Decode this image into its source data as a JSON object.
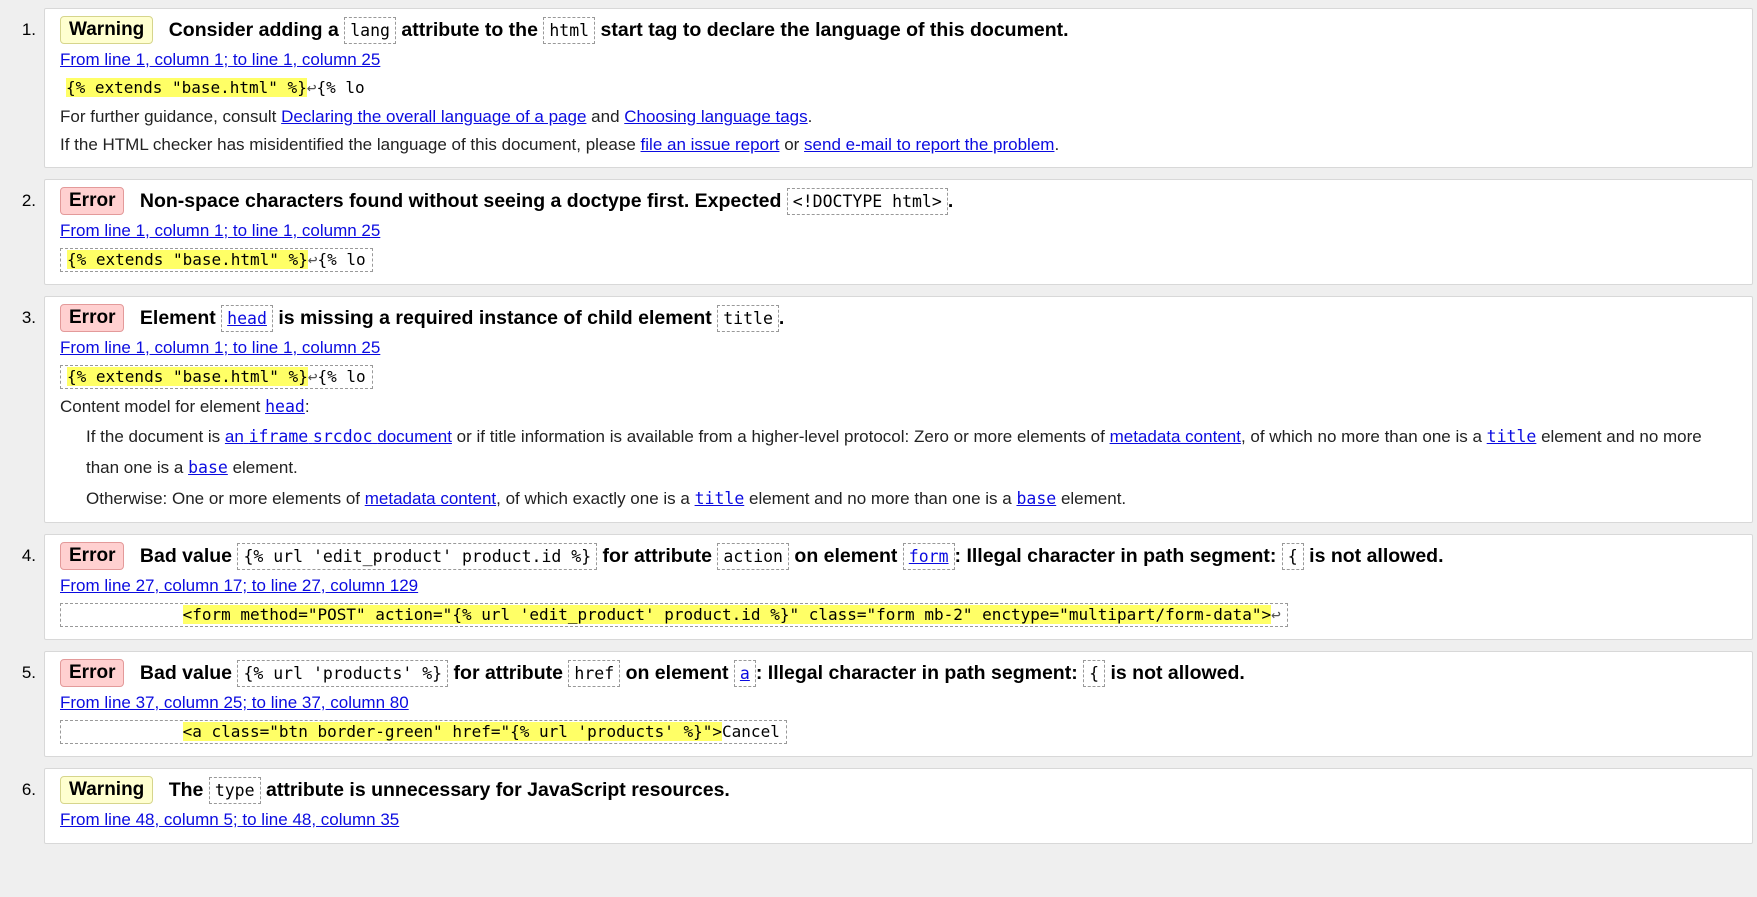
{
  "messages": [
    {
      "num": "1.",
      "type": "Warning",
      "text_a": "Consider adding a",
      "code_a": "lang",
      "text_b": "attribute to the",
      "code_b": "html",
      "text_c": "start tag to declare the language of this document.",
      "location": "From line 1, column 1; to line 1, column 25",
      "extract_hl": "{% extends \"base.html\" %}",
      "extract_ret": "↩",
      "extract_rest": "{% lo",
      "guidance_pre": "For further guidance, consult",
      "guidance_link1": "Declaring the overall language of a page",
      "guidance_and": "and",
      "guidance_link2": "Choosing language tags",
      "guidance_end": ".",
      "misid_pre": "If the HTML checker has misidentified the language of this document, please",
      "misid_link1": "file an issue report",
      "misid_or": "or",
      "misid_link2": "send e-mail to report the problem",
      "misid_end": "."
    },
    {
      "num": "2.",
      "type": "Error",
      "text_a": "Non-space characters found without seeing a doctype first. Expected",
      "code_a": "<!DOCTYPE html>",
      "text_b": ".",
      "location": "From line 1, column 1; to line 1, column 25",
      "extract_hl": "{% extends \"base.html\" %}",
      "extract_ret": "↩",
      "extract_rest": "{% lo"
    },
    {
      "num": "3.",
      "type": "Error",
      "text_a": "Element",
      "code_a": "head",
      "text_b": "is missing a required instance of child element",
      "code_b": "title",
      "text_c": ".",
      "location": "From line 1, column 1; to line 1, column 25",
      "extract_hl": "{% extends \"base.html\" %}",
      "extract_ret": "↩",
      "extract_rest": "{% lo",
      "cm_pre": "Content model for element",
      "cm_link": "head",
      "cm_post": ":",
      "cm1_pre": "If the document is",
      "cm1_link_a": "an",
      "cm1_link_code": "iframe",
      "cm1_link_code2": "srcdoc",
      "cm1_link_b": "document",
      "cm1_mid": "or if title information is available from a higher-level protocol: Zero or more elements of",
      "cm1_link2": "metadata content",
      "cm1_mid2": ", of which no more than one is a",
      "cm1_code": "title",
      "cm1_mid3": "element and no more than one is a",
      "cm1_code2": "base",
      "cm1_end": "element.",
      "cm2_pre": "Otherwise: One or more elements of",
      "cm2_link": "metadata content",
      "cm2_mid": ", of which exactly one is a",
      "cm2_code": "title",
      "cm2_mid2": "element and no more than one is a",
      "cm2_code2": "base",
      "cm2_end": "element."
    },
    {
      "num": "4.",
      "type": "Error",
      "text_a": "Bad value",
      "code_a": "{% url 'edit_product' product.id %}",
      "text_b": "for attribute",
      "code_b": "action",
      "text_c": "on element",
      "code_c": "form",
      "text_d": ": Illegal character in path segment:",
      "code_d": "{",
      "text_e": "is not allowed.",
      "location": "From line 27, column 17; to line 27, column 129",
      "extract_pre": "            ",
      "extract_hl": "<form method=\"POST\" action=\"{% url 'edit_product' product.id %}\" class=\"form mb-2\" enctype=\"multipart/form-data\">",
      "extract_ret": "↩"
    },
    {
      "num": "5.",
      "type": "Error",
      "text_a": "Bad value",
      "code_a": "{% url 'products' %}",
      "text_b": "for attribute",
      "code_b": "href",
      "text_c": "on element",
      "code_c": "a",
      "text_d": ": Illegal character in path segment:",
      "code_d": "{",
      "text_e": "is not allowed.",
      "location": "From line 37, column 25; to line 37, column 80",
      "extract_pre": "            ",
      "extract_hl": "<a class=\"btn border-green\" href=\"{% url 'products' %}\">",
      "extract_rest": "Cancel"
    },
    {
      "num": "6.",
      "type": "Warning",
      "text_a": "The",
      "code_a": "type",
      "text_b": "attribute is unnecessary for JavaScript resources.",
      "location": "From line 48, column 5; to line 48, column 35"
    }
  ]
}
